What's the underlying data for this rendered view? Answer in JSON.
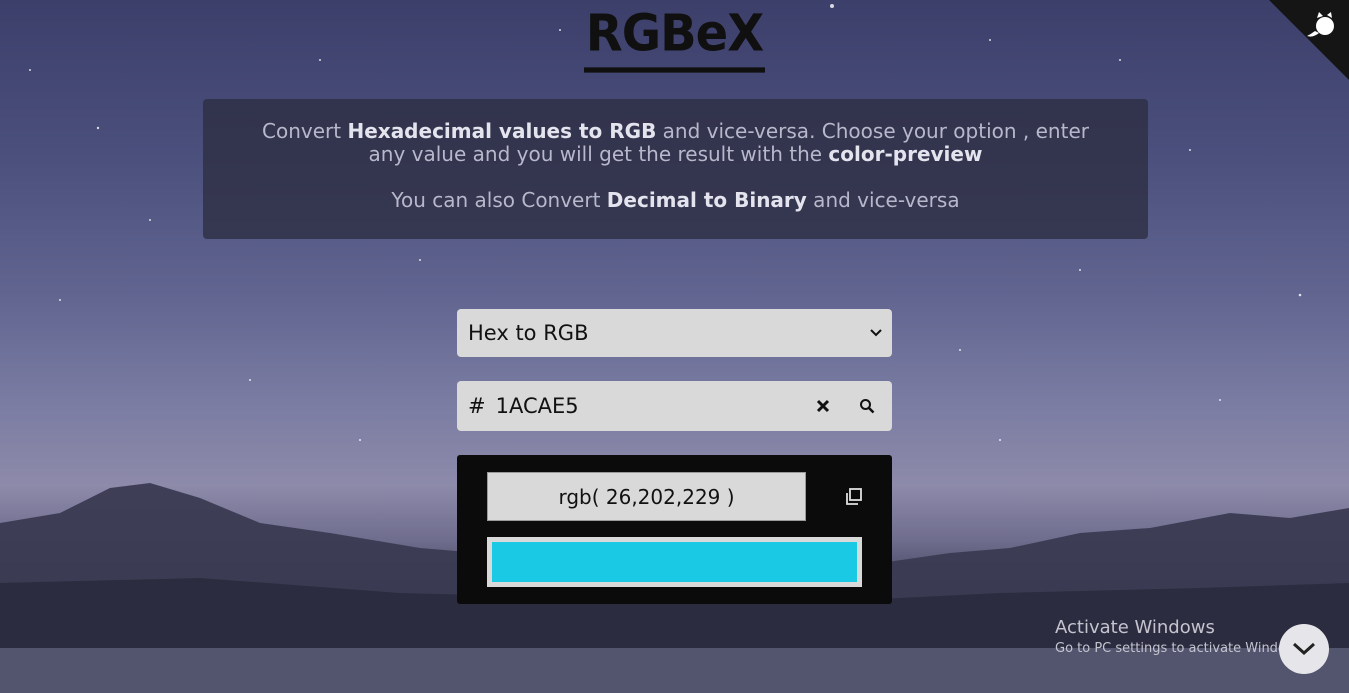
{
  "header": {
    "title": "RGBeX"
  },
  "info": {
    "line1_pre": "Convert ",
    "line1_bold1": "Hexadecimal values to RGB",
    "line1_mid": " and vice-versa. Choose your option , enter any value and you will get the result with the ",
    "line1_bold2": "color-preview",
    "line2_pre": "You can also Convert ",
    "line2_bold": "Decimal to Binary",
    "line2_post": " and vice-versa"
  },
  "converter": {
    "mode_selected": "Hex to RGB",
    "input_prefix": "#",
    "input_value": "1ACAE5",
    "result_text": "rgb( 26,202,229 )",
    "preview_color": "#1ACAE5"
  },
  "icons": {
    "corner": "github-octocat-icon",
    "select_arrow": "chevron-down-icon",
    "clear": "close-icon",
    "search": "search-icon",
    "copy": "copy-icon",
    "scroll": "chevron-down-icon"
  },
  "watermark": {
    "line1": "Activate Windows",
    "line2": "Go to PC settings to activate Windows."
  }
}
